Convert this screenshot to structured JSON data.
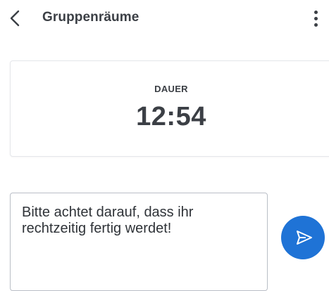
{
  "header": {
    "title": "Gruppenräume",
    "back_icon": "chevron-left-icon",
    "menu_icon": "more-vertical-icon"
  },
  "duration": {
    "label": "DAUER",
    "value": "12:54"
  },
  "message": {
    "value": "Bitte achtet darauf, dass ihr rechtzeitig fertig werdet!",
    "placeholder": ""
  },
  "send": {
    "icon": "send-icon",
    "color": "#1f73d6"
  }
}
